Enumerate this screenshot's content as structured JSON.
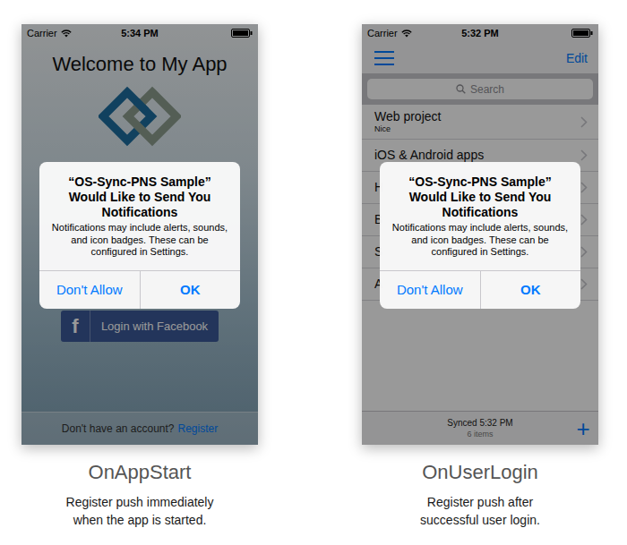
{
  "login_screen": {
    "status_bar": {
      "carrier": "Carrier",
      "time": "5:34 PM"
    },
    "title": "Welcome to My App",
    "facebook_button": {
      "icon": "f",
      "label": "Login with Facebook"
    },
    "footer": {
      "prompt": "Don't have an account?",
      "link": "Register"
    },
    "alert": {
      "title": "“OS-Sync-PNS Sample” Would Like to Send You Notifications",
      "message": "Notifications may include alerts, sounds, and icon badges. These can be configured in Settings.",
      "buttons": [
        "Don't Allow",
        "OK"
      ]
    }
  },
  "list_screen": {
    "status_bar": {
      "carrier": "Carrier",
      "time": "5:32 PM"
    },
    "nav_bar": {
      "right_button": "Edit"
    },
    "search": {
      "placeholder": "Search"
    },
    "rows": [
      {
        "title": "Web project",
        "subtitle": "Nice"
      },
      {
        "title": "iOS & Android apps"
      },
      {
        "title": "H"
      },
      {
        "title": "B"
      },
      {
        "title": "S"
      },
      {
        "title": "A"
      }
    ],
    "toolbar": {
      "status": "Synced 5:32 PM",
      "count": "6 items",
      "add": "+"
    },
    "alert": {
      "title": "“OS-Sync-PNS Sample” Would Like to Send You Notifications",
      "message": "Notifications may include alerts, sounds, and icon badges. These can be configured in Settings.",
      "buttons": [
        "Don't Allow",
        "OK"
      ]
    }
  },
  "captions": [
    {
      "title": "OnAppStart",
      "lines": [
        "Register push immediately",
        "when the app is started."
      ]
    },
    {
      "title": "OnUserLogin",
      "lines": [
        "Register push after",
        "successful user login."
      ]
    }
  ]
}
